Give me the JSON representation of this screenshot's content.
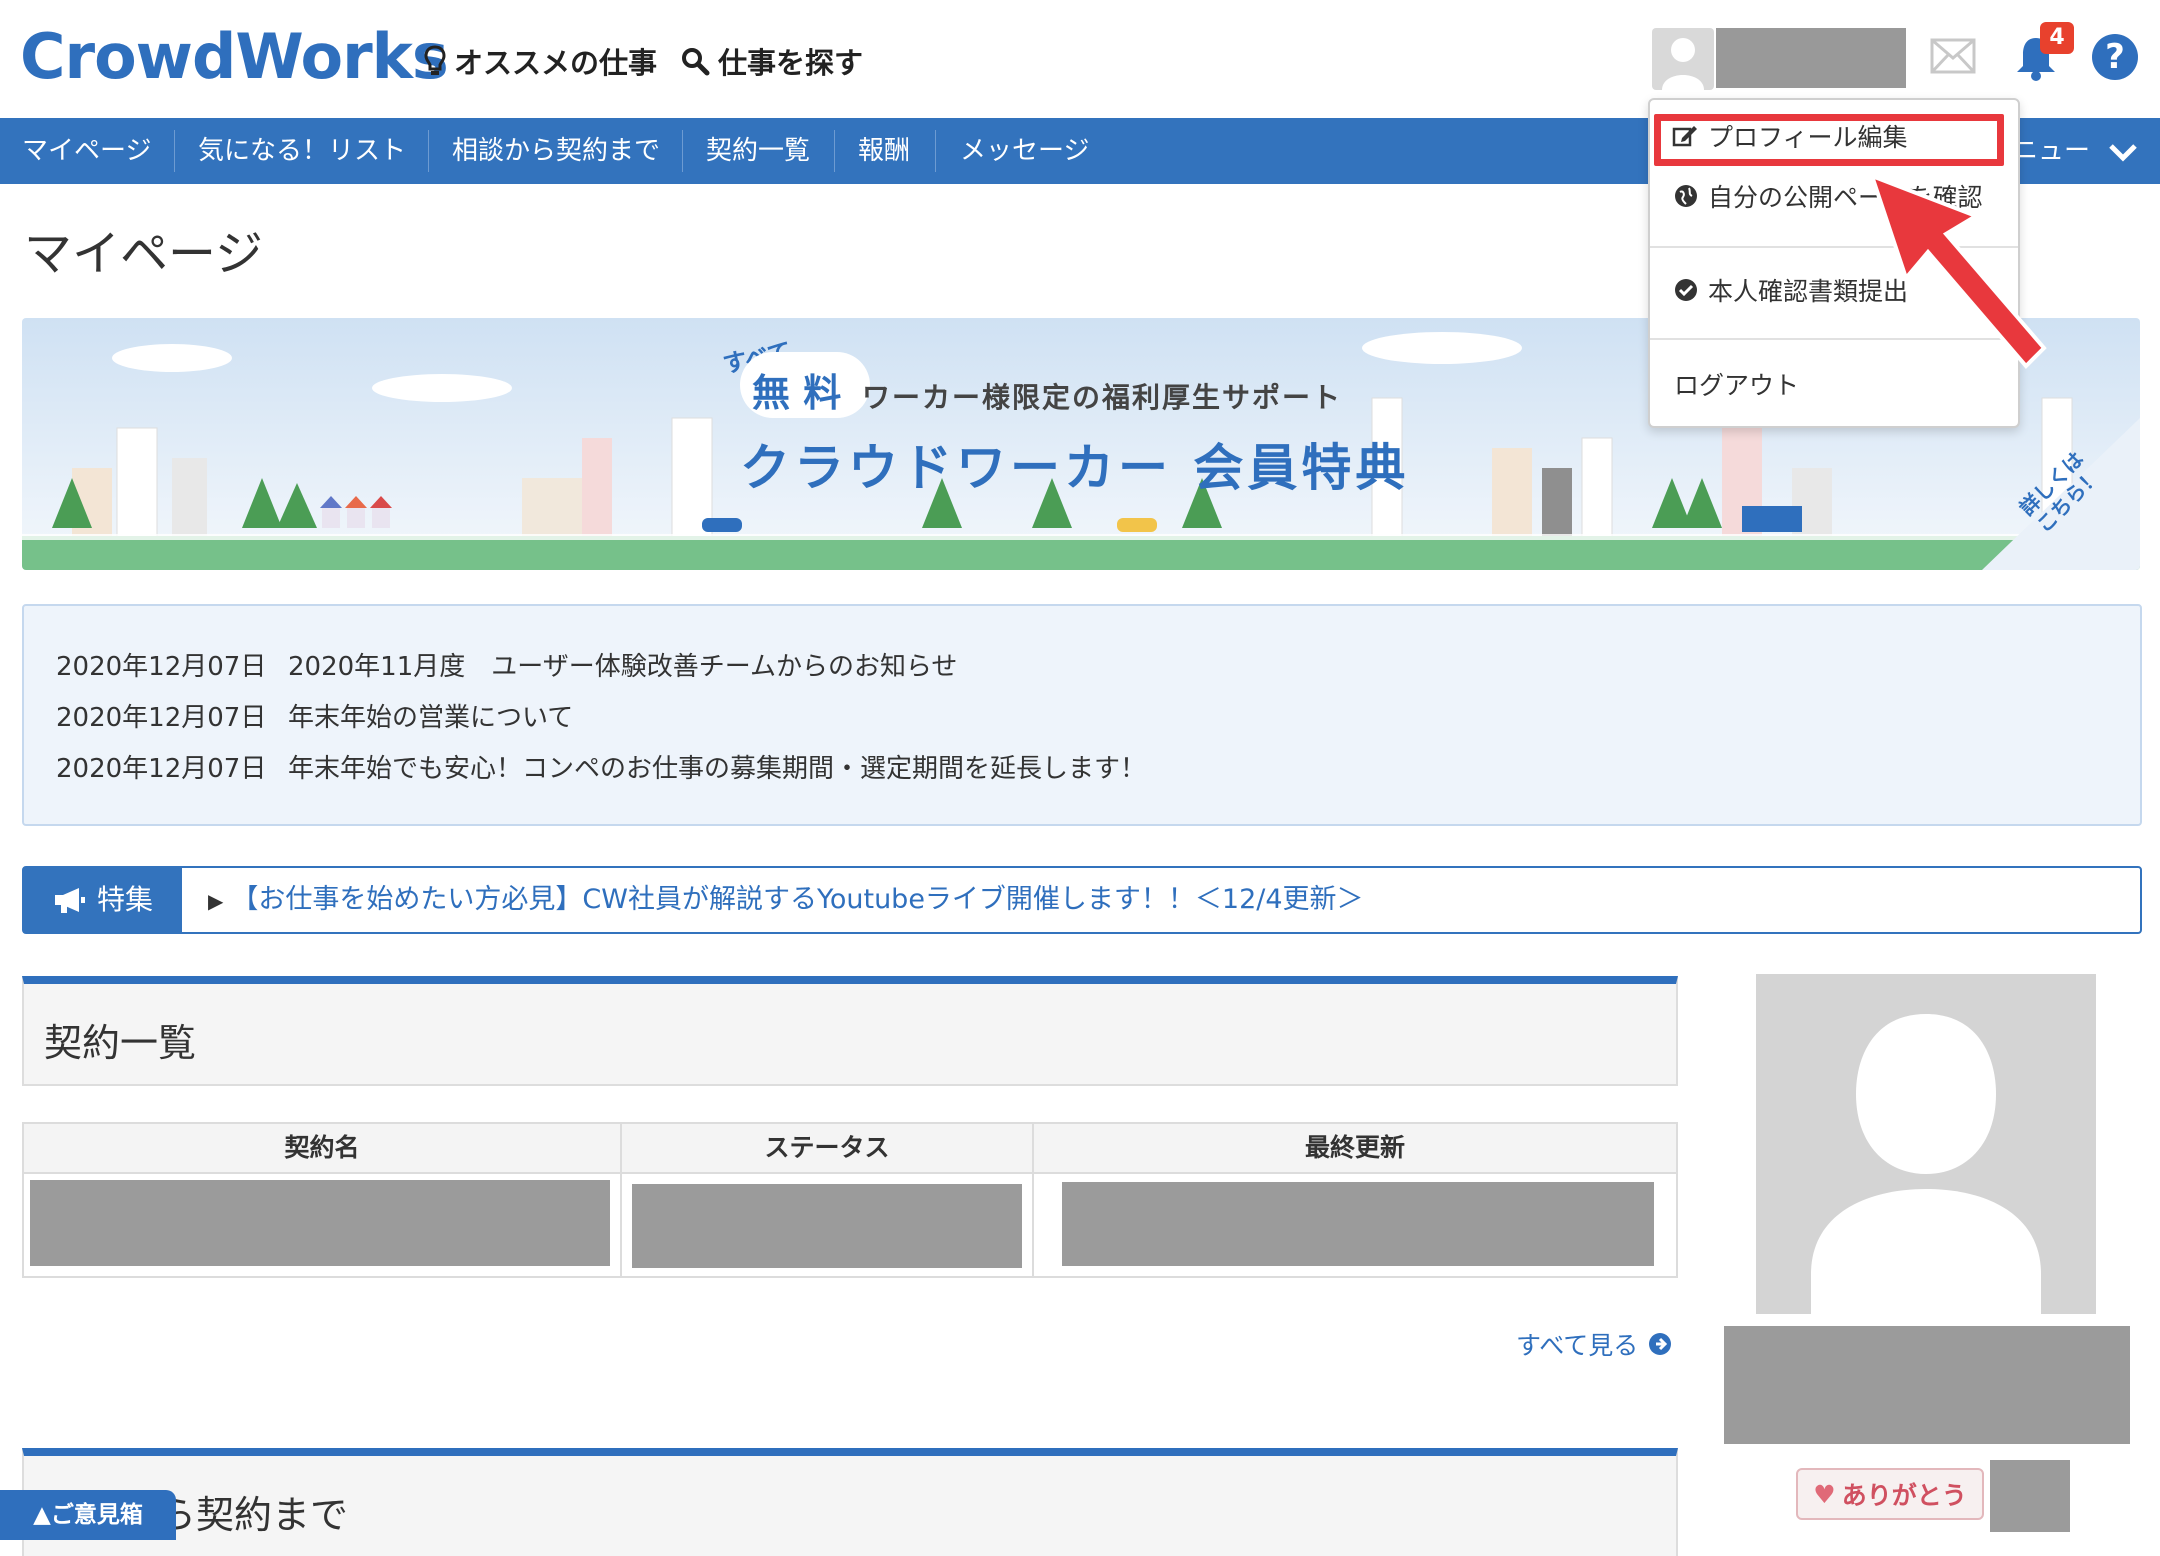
{
  "header": {
    "logo": "CrowdWorks",
    "nav_recommended": "オススメの仕事",
    "nav_search": "仕事を探す",
    "notification_count": "4",
    "help_label": "?"
  },
  "bluenav": {
    "items": [
      "マイページ",
      "気になる！リスト",
      "相談から契約まで",
      "契約一覧",
      "報酬",
      "メッセージ"
    ],
    "menu_tail": "ニュー"
  },
  "dropdown": {
    "profile_edit": "プロフィール編集",
    "public_page": "自分の公開ページを確認",
    "identity_docs": "本人確認書類提出",
    "logout": "ログアウト"
  },
  "page": {
    "title": "マイページ"
  },
  "banner": {
    "all": "すべて",
    "free": "無 料",
    "subtitle": "ワーカー様限定の福利厚生サポート",
    "main": "クラウドワーカー 会員特典",
    "corner": "詳しくは\nこちら！"
  },
  "news": [
    {
      "date": "2020年12月07日",
      "text": "2020年11月度　ユーザー体験改善チームからのお知らせ"
    },
    {
      "date": "2020年12月07日",
      "text": "年末年始の営業について"
    },
    {
      "date": "2020年12月07日",
      "text": "年末年始でも安心！コンペのお仕事の募集期間・選定期間を延長します！"
    }
  ],
  "feature": {
    "tag": "特集",
    "link": "【お仕事を始めたい方必見】CW社員が解説するYoutubeライブ開催します！！＜12/4更新＞"
  },
  "contracts": {
    "title": "契約一覧",
    "columns": [
      "契約名",
      "ステータス",
      "最終更新"
    ],
    "see_all": "すべて見る"
  },
  "consult": {
    "title": "相談から契約まで"
  },
  "profile": {
    "thanks": "ありがとう"
  },
  "feedback": "▲ご意見箱",
  "colors": {
    "brand_blue": "#3373bd",
    "highlight_red": "#e8383d",
    "badge_red": "#e8412d"
  }
}
